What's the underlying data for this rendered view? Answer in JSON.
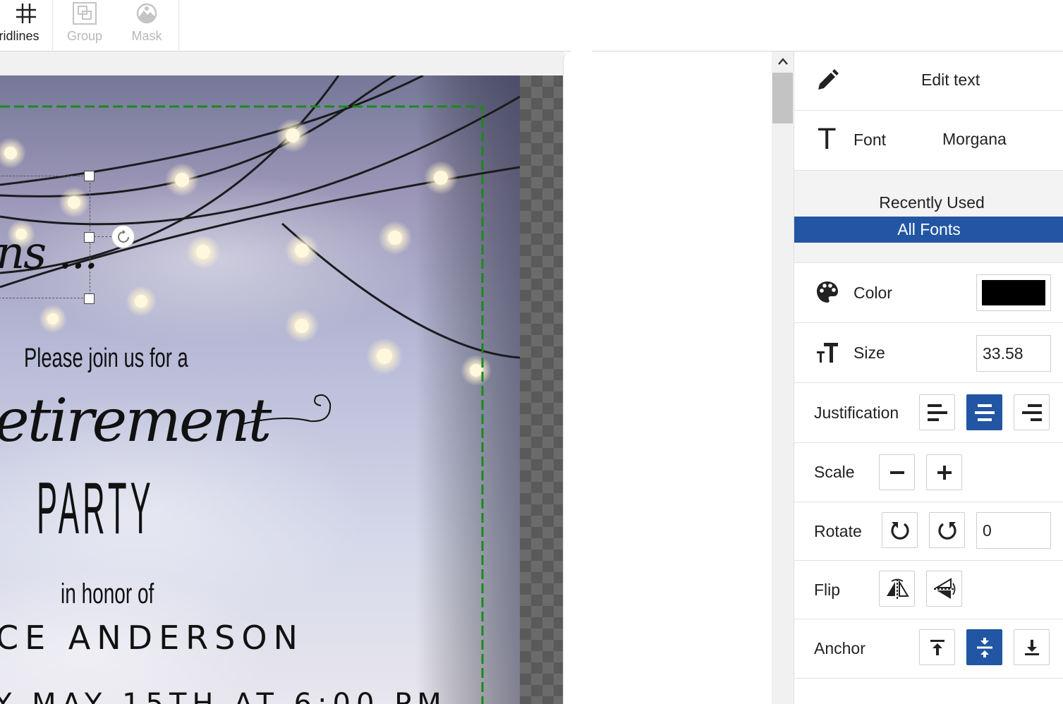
{
  "toolbar": {
    "gridlines_label": "ridlines",
    "group_label": "Group",
    "mask_label": "Mask"
  },
  "card": {
    "greeting_fragment": "ns ...",
    "join_line": "Please join us for a",
    "retirement_fragment": "etirement",
    "party": "PARTY",
    "honor_line": "in honor of",
    "name_fragment": "CE ANDERSON",
    "date_fragment": "Y MAY 15TH AT 6:00 PM"
  },
  "panel": {
    "edit_text": "Edit text",
    "font_label": "Font",
    "font_value": "Morgana",
    "recently_used": "Recently Used",
    "all_fonts": "All Fonts",
    "color_label": "Color",
    "color_value": "#000000",
    "size_label": "Size",
    "size_value": "33.58",
    "justification_label": "Justification",
    "justification_active": "center",
    "scale_label": "Scale",
    "rotate_label": "Rotate",
    "rotate_value": "0",
    "flip_label": "Flip",
    "anchor_label": "Anchor",
    "anchor_active": "middle"
  },
  "colors": {
    "accent": "#2255a4",
    "selection_dashes": "#1a8a1a"
  }
}
